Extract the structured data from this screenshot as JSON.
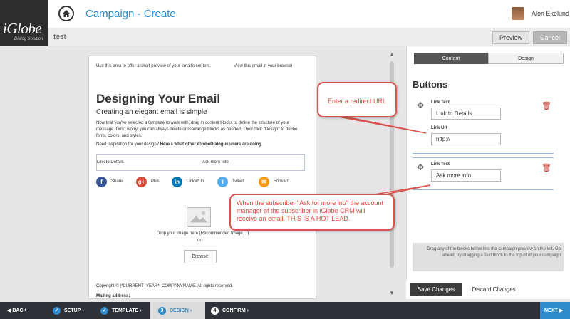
{
  "brand": {
    "name": "iGlobe",
    "tagline": "Dialog Solution"
  },
  "header": {
    "title": "Campaign - Create",
    "user": "Alon Ekelund"
  },
  "subbar": {
    "campaign_name": "test",
    "preview_label": "Preview",
    "cancel_label": "Cancel"
  },
  "email": {
    "preheader": "Use this area to offer a short preview of your email's content.",
    "view_in_browser": "View this email in your browser",
    "heading": "Designing Your Email",
    "subheading": "Creating an elegant email is simple",
    "body": "Now that you've selected a template to work with, drag in content blocks to define the structure of your message. Don't worry, you can always delete or rearrange blocks as needed. Then click \"Design\" to define fonts, colors, and styles.",
    "inspiration_prefix": "Need inspiration for your design? ",
    "inspiration_link": "Here's what other iGlobeDialogue users are doing.",
    "button1": "Link to Details",
    "button2": "Ask more info",
    "social": [
      {
        "icon": "facebook-icon",
        "glyph": "f",
        "label": "Share",
        "color": "#3b5998"
      },
      {
        "icon": "google-plus-icon",
        "glyph": "g+",
        "label": "Plus",
        "color": "#dd4b39"
      },
      {
        "icon": "linkedin-icon",
        "glyph": "in",
        "label": "Linked In",
        "color": "#0077b5"
      },
      {
        "icon": "twitter-icon",
        "glyph": "t",
        "label": "Tweet",
        "color": "#55acee"
      },
      {
        "icon": "forward-icon",
        "glyph": "✉",
        "label": "Forward",
        "color": "#f39c12"
      }
    ],
    "drop_text": "Drop your image here (Recommended Image ...)",
    "or_text": "or",
    "browse_label": "Browse",
    "copyright": "Copyright © |*CURRENT_YEAR*| COMPANYNAME. All rights reserved.",
    "mailing": "Mailing address:"
  },
  "panel": {
    "tab_content": "Content",
    "tab_design": "Design",
    "title": "Buttons",
    "link_text_label": "Link Text",
    "link_url_label": "Link Url",
    "block1_text": "Link to Details",
    "block1_url": "http://",
    "block2_text": "Ask more info",
    "hint": "Drag any of the blocks below into the campaign preview on the left. Go ahead, try dragging a Text block to the top of of your campaign",
    "save_label": "Save Changes",
    "discard_label": "Discard Changes"
  },
  "callouts": {
    "redirect": "Enter a redirect URL",
    "hot_lead": "When the subscriber \"Ask for more ino\" the account manager of the subscriber in iGlobe CRM will receive an email. THIS IS A HOT LEAD."
  },
  "footer": {
    "back": "BACK",
    "steps": [
      {
        "num": "",
        "label": "SETUP"
      },
      {
        "num": "",
        "label": "TEMPLATE"
      },
      {
        "num": "3",
        "label": "DESIGN"
      },
      {
        "num": "4",
        "label": "CONFIRM"
      }
    ],
    "next": "NEXT"
  },
  "colors": {
    "accent": "#2e8ccd",
    "callout": "#e0433a",
    "footer": "#2e3238"
  }
}
